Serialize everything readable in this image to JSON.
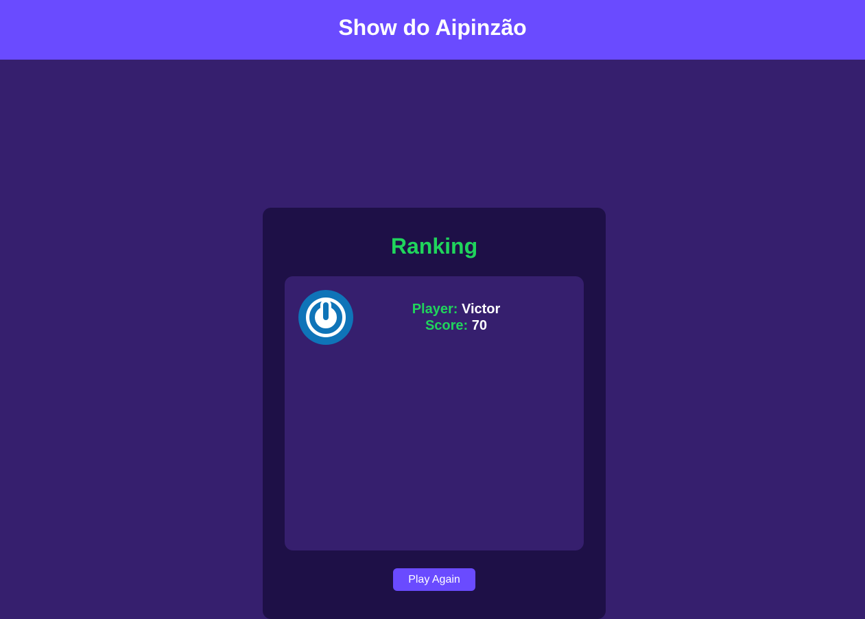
{
  "header": {
    "title": "Show do Aipinzão"
  },
  "ranking": {
    "title": "Ranking",
    "entries": [
      {
        "player_label": "Player:",
        "player_name": "Victor",
        "score_label": "Score:",
        "score": "70",
        "avatar_icon": "power-icon"
      }
    ]
  },
  "actions": {
    "play_again_label": "Play Again"
  },
  "colors": {
    "header_bg": "#6a4bff",
    "page_bg": "#361f6e",
    "card_bg": "#1e1047",
    "accent_green": "#20d45c",
    "button_bg": "#6a4bff",
    "avatar_blue": "#0f74b8"
  }
}
